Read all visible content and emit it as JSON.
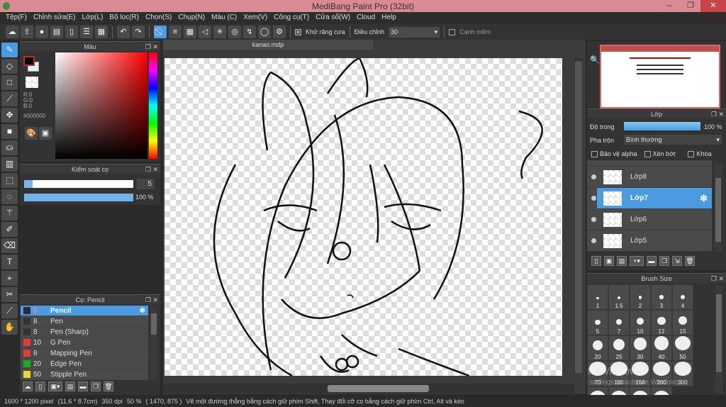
{
  "window": {
    "title": "MediBang Paint Pro (32bit)",
    "minimize": "–",
    "maximize": "❐",
    "close": "✕"
  },
  "menu": [
    "Tệp(F)",
    "Chỉnh sửa(E)",
    "Lớp(L)",
    "Bộ lọc(R)",
    "Chọn(S)",
    "Chụp(N)",
    "Màu (C)",
    "Xem(V)",
    "Công cụ(T)",
    "Cửa sổ(W)",
    "Cloud",
    "Help"
  ],
  "toolbar": {
    "antialias_label": "Khử răng cưa",
    "antialias_checked": true,
    "adjust_label": "Điều chỉnh",
    "adjust_value": "30",
    "soft_edge_label": "Cạnh mềm",
    "soft_edge_checked": false
  },
  "color_panel": {
    "title": "Màu",
    "r": "R:0",
    "g": "G:0",
    "b": "B:0",
    "hex": "#000000",
    "fg": "#000000",
    "bg": "#d8f5ee"
  },
  "brush_control": {
    "title": "Kiểm soát cọ",
    "size": "5",
    "opacity": "100 %",
    "opacity_value": 100
  },
  "brush_panel": {
    "title": "Cọ: Pencil",
    "items": [
      {
        "size": "5",
        "name": "Pencil",
        "color": "#2a2a3a",
        "selected": true
      },
      {
        "size": "8",
        "name": "Pen",
        "color": "#333333"
      },
      {
        "size": "8",
        "name": "Pen (Sharp)",
        "color": "#333333"
      },
      {
        "size": "10",
        "name": "G Pen",
        "color": "#e53935"
      },
      {
        "size": "8",
        "name": "Mapping Pen",
        "color": "#e53935"
      },
      {
        "size": "20",
        "name": "Edge Pen",
        "color": "#1aaa1a"
      },
      {
        "size": "50",
        "name": "Stipple Pen",
        "color": "#e8d820"
      }
    ]
  },
  "document": {
    "tab": "kanao.mdp"
  },
  "layer_panel": {
    "title": "Lớp",
    "opacity_label": "Độ trong",
    "opacity": "100 %",
    "blend_label": "Pha trộn",
    "blend_value": "Bình thường",
    "protect_alpha": "Bảo vệ alpha",
    "clipping": "Xén bớt",
    "lock": "Khóa",
    "layers": [
      "Lớp8",
      "Lớp7",
      "Lớp6",
      "Lớp5"
    ],
    "selected": "Lớp7"
  },
  "brush_size_panel": {
    "title": "Brush Size",
    "sizes": [
      "1",
      "1.5",
      "2",
      "3",
      "4",
      "5",
      "7",
      "10",
      "12",
      "15",
      "20",
      "25",
      "30",
      "40",
      "50",
      "70",
      "100",
      "150",
      "200",
      "300"
    ]
  },
  "status": {
    "dimensions": "1600 * 1200 pixel",
    "physical": "(11.6 * 8.7cm)",
    "dpi": "350 dpi",
    "zoom": "50 %",
    "coords": "( 1470, 875 )",
    "hint": "Vẽ một đường thẳng bằng cách giữ phím Shift, Thay đổi cỡ cọ bằng cách giữ phím Ctrl, Alt và kéo"
  },
  "watermark": {
    "line1": "Activate Windows",
    "line2": "Go to PC settings to activate Windows."
  }
}
